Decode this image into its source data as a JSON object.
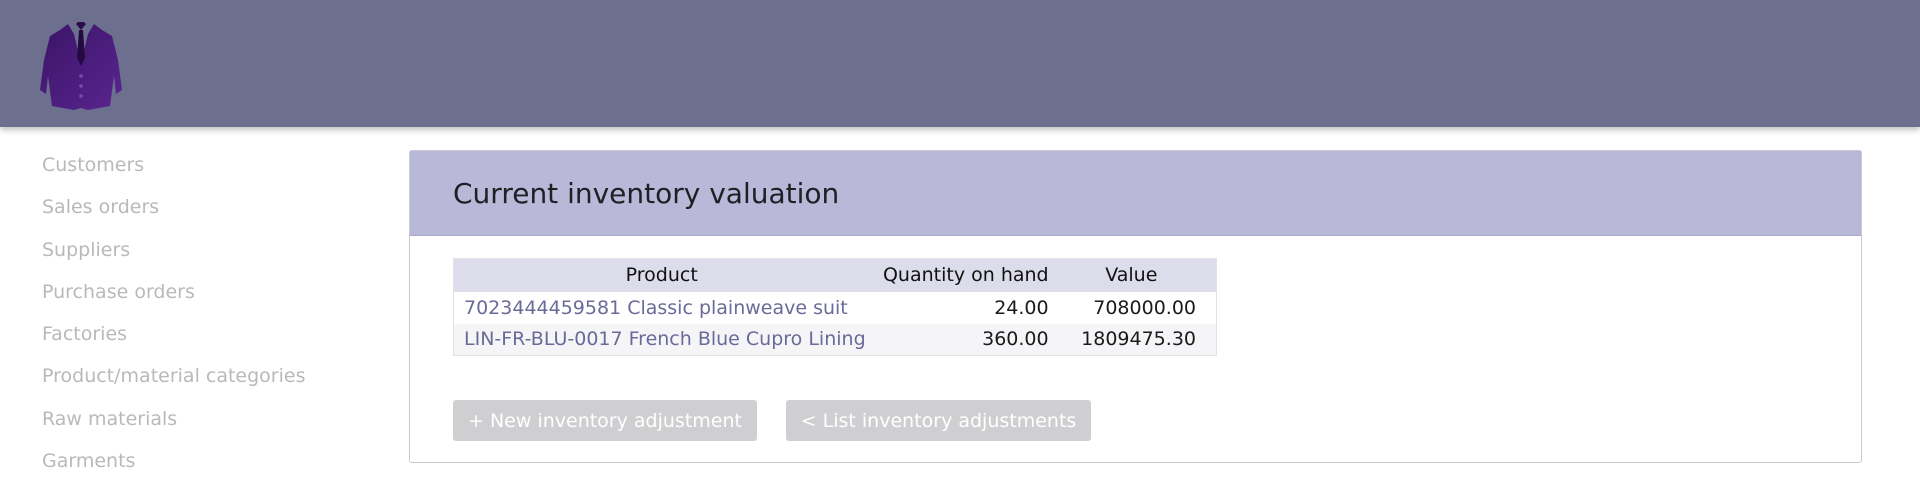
{
  "header": {
    "logo_icon": "suit-jacket-icon",
    "background": "#6d6f8e",
    "logo_color": "#4a1a7a"
  },
  "sidebar": {
    "items": [
      {
        "label": "Customers"
      },
      {
        "label": "Sales orders"
      },
      {
        "label": "Suppliers"
      },
      {
        "label": "Purchase orders"
      },
      {
        "label": "Factories"
      },
      {
        "label": "Product/material categories"
      },
      {
        "label": "Raw materials"
      },
      {
        "label": "Garments"
      }
    ]
  },
  "main": {
    "title": "Current inventory valuation",
    "table": {
      "headers": {
        "product": "Product",
        "quantity": "Quantity on hand",
        "value": "Value"
      },
      "rows": [
        {
          "product": "7023444459581 Classic plainweave suit",
          "quantity": "24.00",
          "value": "708000.00"
        },
        {
          "product": "LIN-FR-BLU-0017 French Blue Cupro Lining",
          "quantity": "360.00",
          "value": "1809475.30"
        }
      ]
    },
    "buttons": {
      "new_adjustment": "+ New inventory adjustment",
      "list_adjustments": "< List inventory adjustments"
    }
  }
}
